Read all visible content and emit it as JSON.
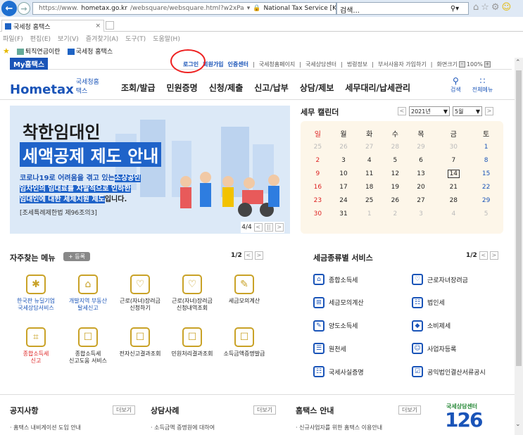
{
  "browser": {
    "url_prefix": "https://www.",
    "url_domain": "hometax.go.kr",
    "url_rest": "/websquare/websquare.html?w2xPa",
    "cert": "National Tax Service [KR]",
    "search_placeholder": "검색...",
    "tab_title": "국세청 홈택스",
    "menu": [
      "파일(F)",
      "편집(E)",
      "보기(V)",
      "즐겨찾기(A)",
      "도구(T)",
      "도움말(H)"
    ],
    "favorites": [
      "퇴직연금이란",
      "국세청 홈택스"
    ]
  },
  "topbar": {
    "myhome": "My홈택스",
    "login": "로그인",
    "join": "회원가입",
    "cert_center": "인증센터",
    "links": [
      "국세청홈페이지",
      "국세상담센터",
      "법령정보",
      "부서사용자 가입하기"
    ],
    "zoom_label": "화면크기",
    "zoom_value": "100%"
  },
  "header": {
    "logo_main": "Hometax",
    "logo_sub": "국세청홈택스",
    "nav": [
      "조회/발급",
      "민원증명",
      "신청/제출",
      "신고/납부",
      "상담/제보",
      "세무대리/납세관리"
    ],
    "search_label": "검색",
    "allmenu_label": "전체메뉴"
  },
  "banner": {
    "title1": "착한임대인",
    "title2": "세액공제 제도 안내",
    "desc_a": "코로나19로 어려움을 겪고 있는",
    "desc_b": "소상공인",
    "desc_c": "임차인의 임대료를 자발적으로 인하한",
    "desc_d": "임대인에 대한 세제지원 제도",
    "desc_e": "입니다.",
    "law": "[조세특례제한법 제96조의3]",
    "page": "4/4"
  },
  "calendar": {
    "title": "세무 캘린더",
    "year": "2021년",
    "month": "5월",
    "weekdays": [
      "일",
      "월",
      "화",
      "수",
      "목",
      "금",
      "토"
    ],
    "rows": [
      [
        "25",
        "26",
        "27",
        "28",
        "29",
        "30",
        "1"
      ],
      [
        "2",
        "3",
        "4",
        "5",
        "6",
        "7",
        "8"
      ],
      [
        "9",
        "10",
        "11",
        "12",
        "13",
        "14",
        "15"
      ],
      [
        "16",
        "17",
        "18",
        "19",
        "20",
        "21",
        "22"
      ],
      [
        "23",
        "24",
        "25",
        "26",
        "27",
        "28",
        "29"
      ],
      [
        "30",
        "31",
        "1",
        "2",
        "3",
        "4",
        "5"
      ]
    ],
    "today": "14"
  },
  "favorites_menu": {
    "title": "자주찾는 메뉴",
    "add": "등록",
    "page": "1/2",
    "items": [
      {
        "l1": "한국판 뉴딜기업",
        "l2": "국세상담서비스",
        "style": "blue"
      },
      {
        "l1": "개발지역 부동산",
        "l2": "탈세신고",
        "style": "blue"
      },
      {
        "l1": "근로(자녀)장려금",
        "l2": "신청하기",
        "style": ""
      },
      {
        "l1": "근로(자녀)장려금",
        "l2": "신청내역조회",
        "style": ""
      },
      {
        "l1": "세금모의계산",
        "l2": "",
        "style": ""
      },
      {
        "l1": "종합소득세",
        "l2": "신고",
        "style": "red"
      },
      {
        "l1": "종합소득세",
        "l2": "신고도움 서비스",
        "style": ""
      },
      {
        "l1": "전자신고결과조회",
        "l2": "",
        "style": ""
      },
      {
        "l1": "민원처리결과조회",
        "l2": "",
        "style": ""
      },
      {
        "l1": "소득금액증명발급",
        "l2": "",
        "style": ""
      }
    ]
  },
  "tax_services": {
    "title": "세금종류별 서비스",
    "page": "1/2",
    "items": [
      "종합소득세",
      "근로자녀장려금",
      "세금모의계산",
      "법인세",
      "양도소득세",
      "소비제세",
      "원천세",
      "사업자등록",
      "국세사실증명",
      "공익법인결산서류공시"
    ]
  },
  "bottom": {
    "notice_title": "공지사항",
    "notice_item": "홈택스 내비게이션 도입 안내",
    "cases_title": "상담사례",
    "cases_item": "소득금액 증명원에 대하여",
    "guide_title": "홈택스 안내",
    "guide_item": "신규사업자를 위한 홈택스 이용안내",
    "more": "더보기",
    "badge_top": "국세상담센터",
    "badge_num": "126"
  },
  "colors": {
    "brand": "#1a54b8",
    "sunday": "#dd2222",
    "highlight": "#e22222"
  }
}
